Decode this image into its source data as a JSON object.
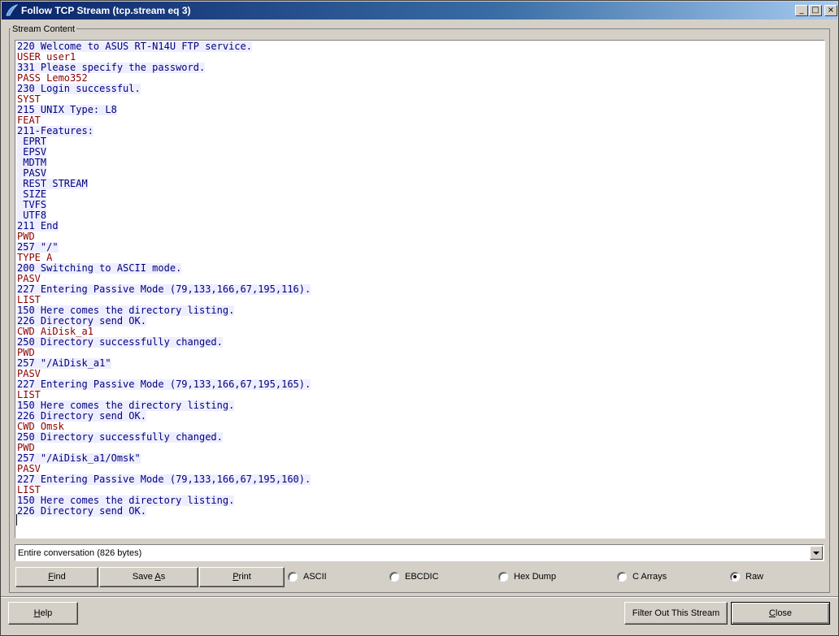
{
  "window": {
    "title": "Follow TCP Stream (tcp.stream eq 3)",
    "controls": {
      "minimize": "_",
      "maximize": "□",
      "close": "×"
    }
  },
  "stream_group_label": "Stream Content",
  "stream_lines": [
    {
      "text": "220 Welcome to ASUS RT-N14U FTP service.",
      "dir": "server"
    },
    {
      "text": "USER user1",
      "dir": "client"
    },
    {
      "text": "331 Please specify the password.",
      "dir": "server"
    },
    {
      "text": "PASS Lemo352",
      "dir": "client"
    },
    {
      "text": "230 Login successful.",
      "dir": "server"
    },
    {
      "text": "SYST",
      "dir": "client"
    },
    {
      "text": "215 UNIX Type: L8",
      "dir": "server"
    },
    {
      "text": "FEAT",
      "dir": "client"
    },
    {
      "text": "211-Features:",
      "dir": "server"
    },
    {
      "text": " EPRT",
      "dir": "server"
    },
    {
      "text": " EPSV",
      "dir": "server"
    },
    {
      "text": " MDTM",
      "dir": "server"
    },
    {
      "text": " PASV",
      "dir": "server"
    },
    {
      "text": " REST STREAM",
      "dir": "server"
    },
    {
      "text": " SIZE",
      "dir": "server"
    },
    {
      "text": " TVFS",
      "dir": "server"
    },
    {
      "text": " UTF8",
      "dir": "server"
    },
    {
      "text": "211 End",
      "dir": "server"
    },
    {
      "text": "PWD",
      "dir": "client"
    },
    {
      "text": "257 \"/\"",
      "dir": "server"
    },
    {
      "text": "TYPE A",
      "dir": "client"
    },
    {
      "text": "200 Switching to ASCII mode.",
      "dir": "server"
    },
    {
      "text": "PASV",
      "dir": "client"
    },
    {
      "text": "227 Entering Passive Mode (79,133,166,67,195,116).",
      "dir": "server"
    },
    {
      "text": "LIST",
      "dir": "client"
    },
    {
      "text": "150 Here comes the directory listing.",
      "dir": "server"
    },
    {
      "text": "226 Directory send OK.",
      "dir": "server"
    },
    {
      "text": "CWD AiDisk_a1",
      "dir": "client"
    },
    {
      "text": "250 Directory successfully changed.",
      "dir": "server"
    },
    {
      "text": "PWD",
      "dir": "client"
    },
    {
      "text": "257 \"/AiDisk_a1\"",
      "dir": "server"
    },
    {
      "text": "PASV",
      "dir": "client"
    },
    {
      "text": "227 Entering Passive Mode (79,133,166,67,195,165).",
      "dir": "server"
    },
    {
      "text": "LIST",
      "dir": "client"
    },
    {
      "text": "150 Here comes the directory listing.",
      "dir": "server"
    },
    {
      "text": "226 Directory send OK.",
      "dir": "server"
    },
    {
      "text": "CWD Omsk",
      "dir": "client"
    },
    {
      "text": "250 Directory successfully changed.",
      "dir": "server"
    },
    {
      "text": "PWD",
      "dir": "client"
    },
    {
      "text": "257 \"/AiDisk_a1/Omsk\"",
      "dir": "server"
    },
    {
      "text": "PASV",
      "dir": "client"
    },
    {
      "text": "227 Entering Passive Mode (79,133,166,67,195,160).",
      "dir": "server"
    },
    {
      "text": "LIST",
      "dir": "client"
    },
    {
      "text": "150 Here comes the directory listing.",
      "dir": "server"
    },
    {
      "text": "226 Directory send OK.",
      "dir": "server"
    }
  ],
  "colors": {
    "client": "#8b0000",
    "server": "#00007f",
    "server_bg": "#eeeeff"
  },
  "conversation_select": {
    "value": "Entire conversation (826 bytes)"
  },
  "buttons": {
    "find": {
      "pre": "",
      "accel": "F",
      "post": "ind"
    },
    "save_as": {
      "pre": "Save ",
      "accel": "A",
      "post": "s"
    },
    "print": {
      "pre": "",
      "accel": "P",
      "post": "rint"
    },
    "help": {
      "pre": "",
      "accel": "H",
      "post": "elp"
    },
    "filter_out": "Filter Out This Stream",
    "close": {
      "pre": "",
      "accel": "C",
      "post": "lose"
    }
  },
  "format_options": [
    {
      "label": "ASCII",
      "checked": false
    },
    {
      "label": "EBCDIC",
      "checked": false
    },
    {
      "label": "Hex Dump",
      "checked": false
    },
    {
      "label": "C Arrays",
      "checked": false
    },
    {
      "label": "Raw",
      "checked": true
    }
  ]
}
